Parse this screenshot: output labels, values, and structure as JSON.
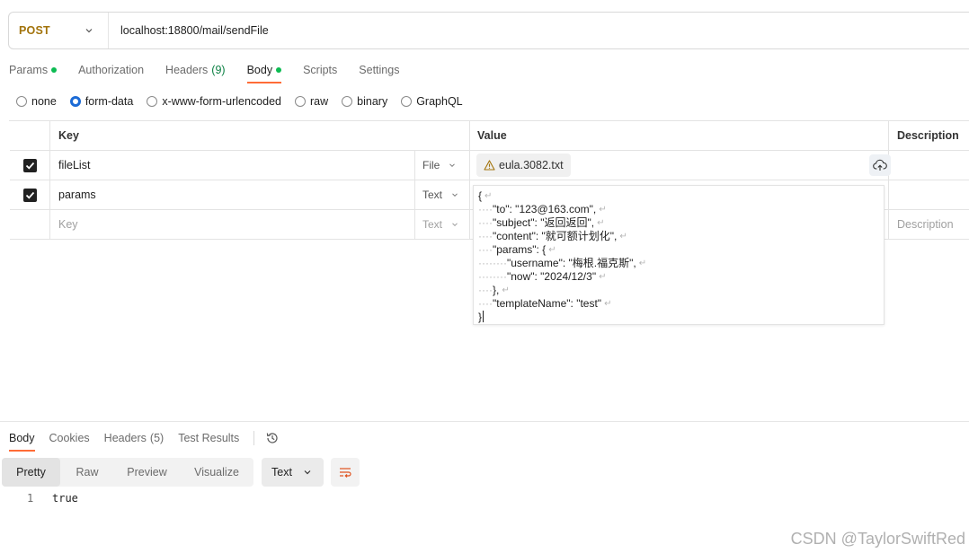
{
  "request": {
    "method": "POST",
    "method_color": "#a2730b",
    "url": "localhost:18800/mail/sendFile"
  },
  "request_tabs": [
    {
      "label": "Params",
      "dot": true,
      "active": false
    },
    {
      "label": "Authorization",
      "active": false
    },
    {
      "label": "Headers",
      "count": "(9)",
      "active": false
    },
    {
      "label": "Body",
      "dot": true,
      "active": true
    },
    {
      "label": "Scripts",
      "active": false
    },
    {
      "label": "Settings",
      "active": false
    }
  ],
  "body_types": [
    {
      "label": "none",
      "selected": false
    },
    {
      "label": "form-data",
      "selected": true
    },
    {
      "label": "x-www-form-urlencoded",
      "selected": false
    },
    {
      "label": "raw",
      "selected": false
    },
    {
      "label": "binary",
      "selected": false
    },
    {
      "label": "GraphQL",
      "selected": false
    }
  ],
  "form_table": {
    "headers": {
      "key": "Key",
      "value": "Value",
      "description": "Description"
    },
    "rows": [
      {
        "checked": true,
        "key": "fileList",
        "type": "File",
        "value": "eula.3082.txt",
        "icon": "warning-icon"
      },
      {
        "checked": true,
        "key": "params",
        "type": "Text",
        "value": ""
      },
      {
        "checked": false,
        "key_placeholder": "Key",
        "type": "Text",
        "desc_placeholder": "Description"
      }
    ]
  },
  "json_editor": {
    "lines": [
      {
        "indent": "",
        "text": "{"
      },
      {
        "indent": "····",
        "text": "\"to\": \"123@163.com\","
      },
      {
        "indent": "····",
        "text": "\"subject\": \"返回返回\","
      },
      {
        "indent": "····",
        "text": "\"content\": \"就可额计划化\","
      },
      {
        "indent": "····",
        "text": "\"params\": {"
      },
      {
        "indent": "········",
        "text": "\"username\": \"梅根.福克斯\","
      },
      {
        "indent": "········",
        "text": "\"now\": \"2024/12/3\""
      },
      {
        "indent": "····",
        "text": "},"
      },
      {
        "indent": "····",
        "text": "\"templateName\": \"test\""
      },
      {
        "indent": "",
        "text": "}"
      }
    ]
  },
  "response": {
    "tabs": [
      {
        "label": "Body",
        "active": true
      },
      {
        "label": "Cookies",
        "active": false
      },
      {
        "label": "Headers",
        "count": "(5)",
        "active": false
      },
      {
        "label": "Test Results",
        "active": false
      }
    ],
    "views": [
      {
        "label": "Pretty",
        "active": true
      },
      {
        "label": "Raw",
        "active": false
      },
      {
        "label": "Preview",
        "active": false
      },
      {
        "label": "Visualize",
        "active": false
      }
    ],
    "format": "Text",
    "lines": [
      {
        "num": "1",
        "text": "true"
      }
    ]
  },
  "watermark": "CSDN @TaylorSwiftRed",
  "colors": {
    "accent": "#ff6c37",
    "dot": "#0cbb52",
    "radio": "#1c6bd6"
  }
}
